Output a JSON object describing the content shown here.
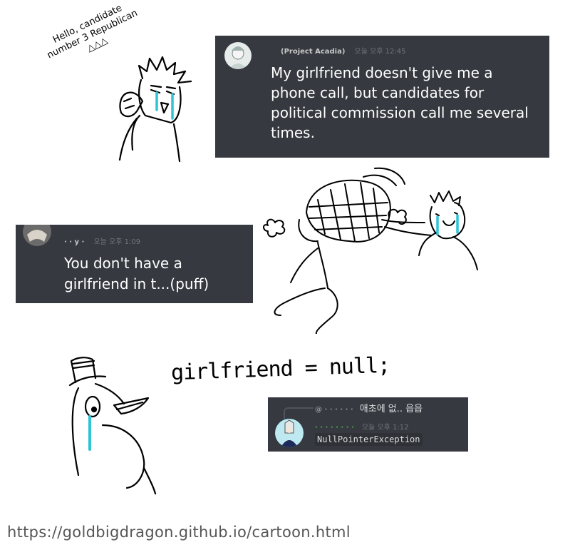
{
  "panel1": {
    "caption": "Hello, candidate number 3 Republican △△△",
    "chat": {
      "username": "(Project Acadia)",
      "timestamp": "오늘 오후 12:45",
      "message": "My girlfriend doesn't give me a phone call, but candidates for political commission call me several times."
    }
  },
  "panel2": {
    "chat": {
      "username": "· · y ·",
      "timestamp": "오늘 오후 1:09",
      "message": "You don't have a girlfriend in t...(puff)"
    }
  },
  "panel3": {
    "code_text": "girlfriend = null;",
    "chat": {
      "reply_text": "애초에 없.. 읍읍",
      "timestamp": "오늘 오후 1:12",
      "code": "NullPointerException"
    }
  },
  "credit_url": "https://goldbigdragon.github.io/cartoon.html",
  "colors": {
    "chat_bg": "#36393f",
    "tears": "#2ec4d6"
  }
}
